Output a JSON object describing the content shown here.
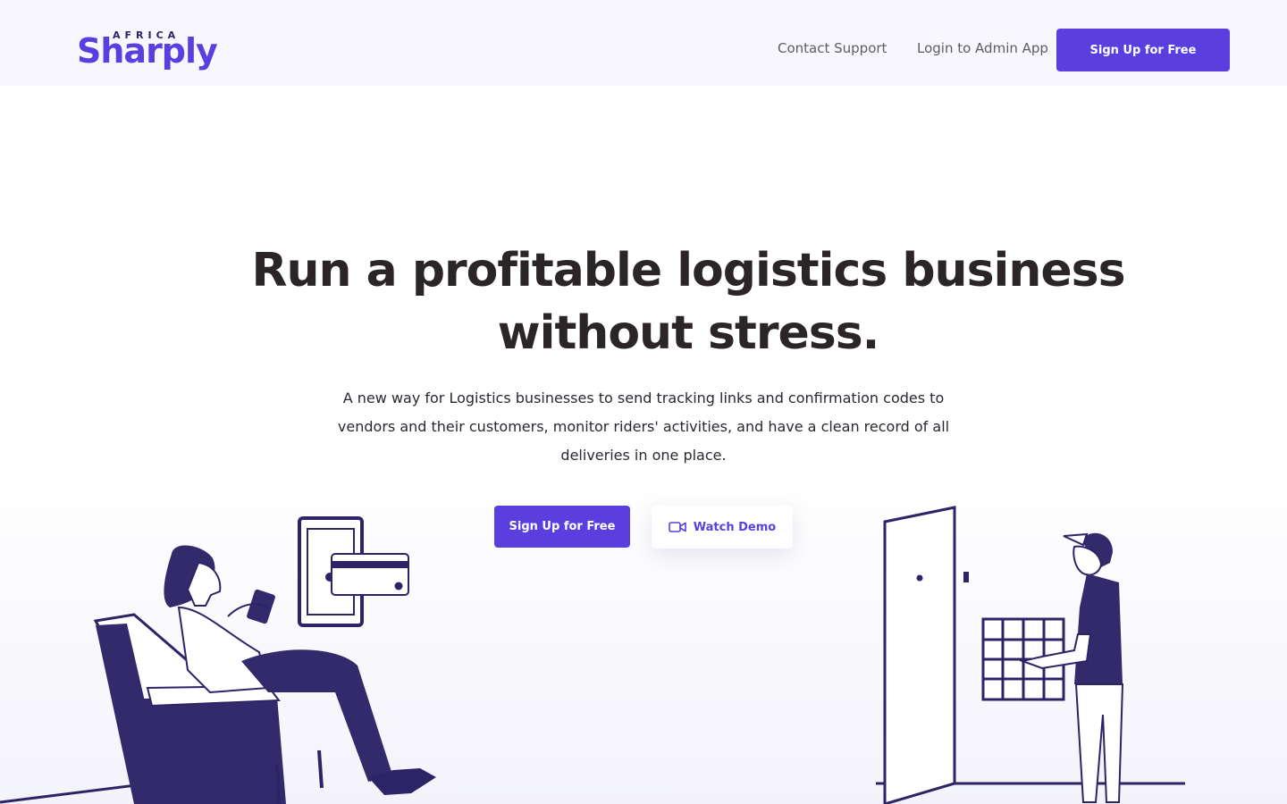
{
  "brand": {
    "name_small": "AFRICA",
    "name_main": "Sharply",
    "accent": "#5b3ee0",
    "ink": "#2d2468"
  },
  "nav": {
    "contact_support": "Contact Support",
    "login_admin": "Login to Admin App",
    "signup": "Sign Up for Free"
  },
  "hero": {
    "headline_line1": "Run a profitable logistics business",
    "headline_line2": "without stress.",
    "subtext_line1": "A new way for Logistics businesses to send tracking links and confirmation codes to",
    "subtext_line2": "vendors and their customers, monitor riders' activities, and have a clean record of all",
    "subtext_line3": "deliveries in one place.",
    "cta_signup": "Sign Up for Free",
    "cta_demo": "Watch Demo",
    "demo_icon": "video-camera-icon"
  }
}
